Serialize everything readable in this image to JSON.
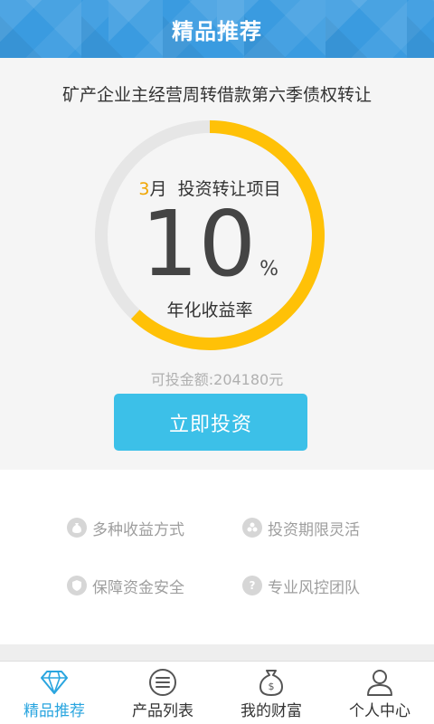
{
  "header": {
    "title": "精品推荐"
  },
  "product": {
    "title": "矿产企业主经营周转借款第六季债权转让",
    "term_number": "3",
    "term_unit": "月",
    "type": "投资转让项目",
    "rate": "10",
    "rate_unit": "%",
    "rate_label": "年化收益率",
    "progress": 0.62,
    "available": "可投金额:204180元",
    "invest_label": "立即投资"
  },
  "features": [
    {
      "label": "多种收益方式",
      "icon": "money-bag-icon"
    },
    {
      "label": "投资期限灵活",
      "icon": "flexible-icon"
    },
    {
      "label": "保障资金安全",
      "icon": "shield-icon"
    },
    {
      "label": "专业风控团队",
      "icon": "question-icon"
    }
  ],
  "tabs": [
    {
      "label": "精品推荐",
      "icon": "diamond-icon",
      "active": true
    },
    {
      "label": "产品列表",
      "icon": "list-icon",
      "active": false
    },
    {
      "label": "我的财富",
      "icon": "wealth-bag-icon",
      "active": false
    },
    {
      "label": "个人中心",
      "icon": "person-icon",
      "active": false
    }
  ],
  "colors": {
    "header": "#3a9be0",
    "accent": "#3cc0e8",
    "ring": "#ffc107",
    "tab_active": "#2aa5df"
  }
}
